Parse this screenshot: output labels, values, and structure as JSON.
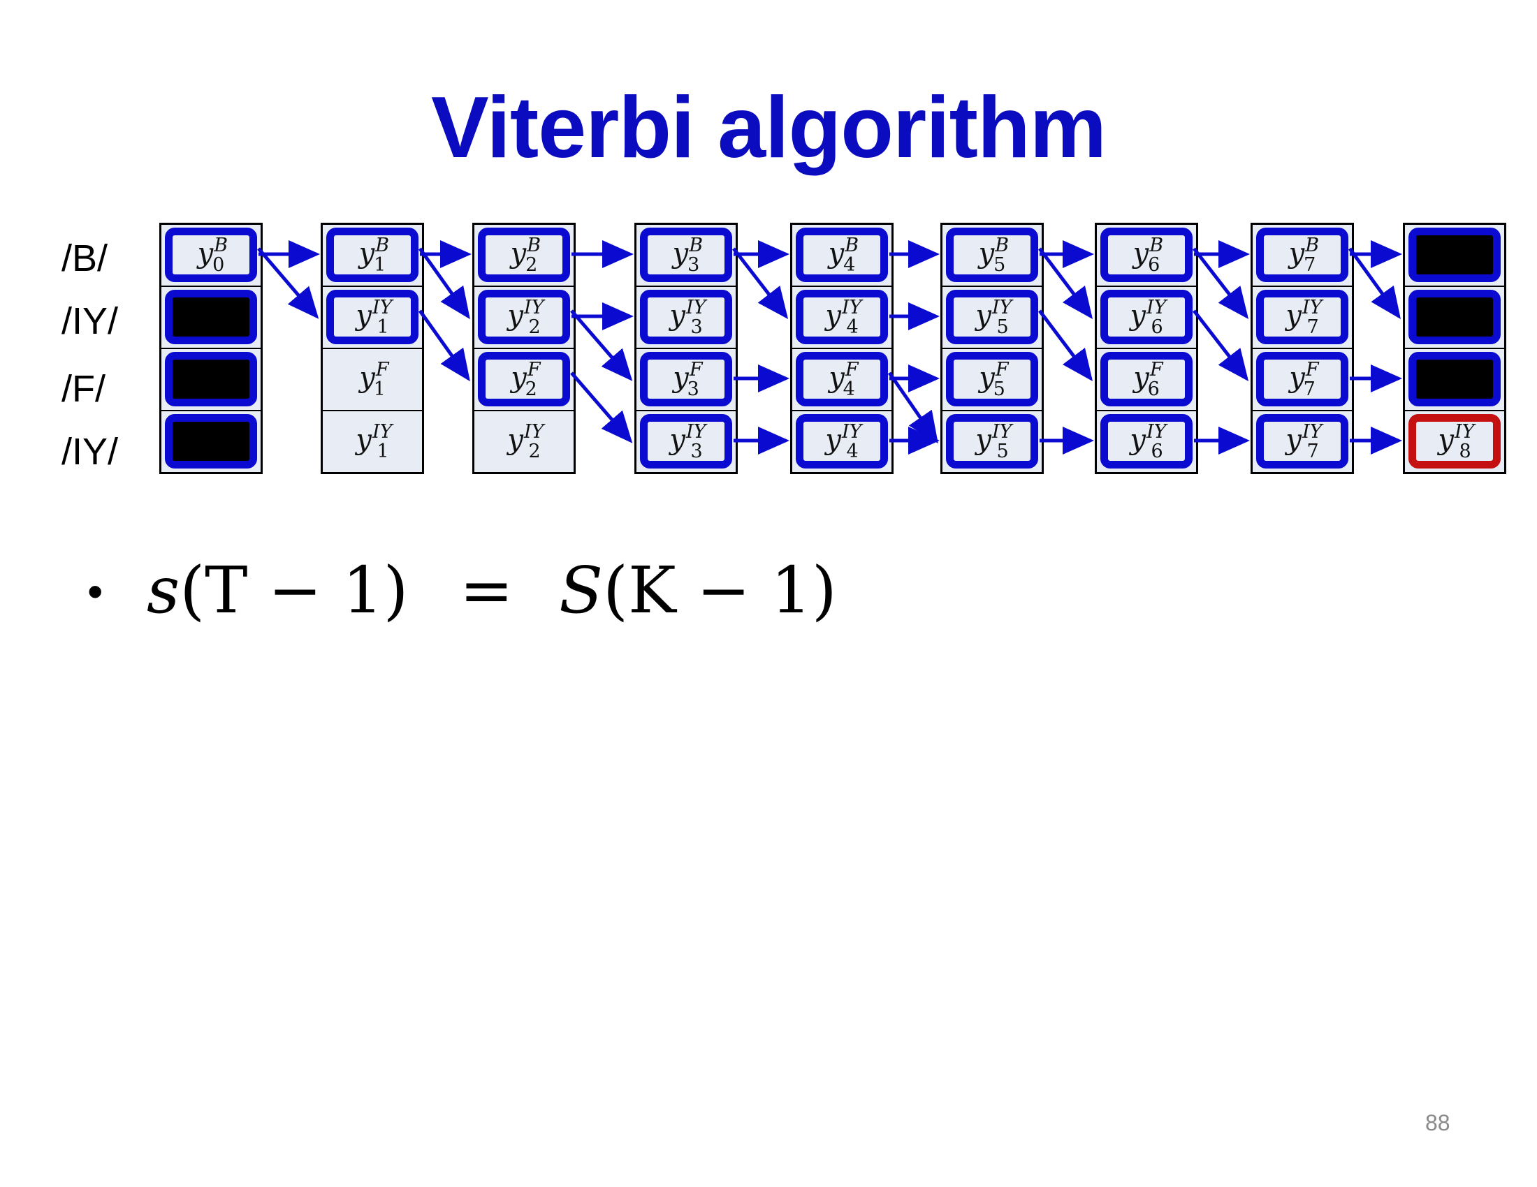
{
  "slide": {
    "title": "Viterbi algorithm",
    "row_labels": [
      "/B/",
      "/IY/",
      "/F/",
      "/IY/"
    ],
    "formula": {
      "lhs_s": "s",
      "lhs_arg": "(T − 1)",
      "eq": "=",
      "rhs_S": "S",
      "rhs_arg": "(K − 1)"
    },
    "bullet": "•",
    "page_number": "88"
  },
  "trellis": {
    "columns": [
      {
        "t": "0",
        "cells": [
          {
            "state": "B",
            "label": "y",
            "sup": "B",
            "sub": "0",
            "visible": true,
            "highlight": "blue",
            "blacked": false
          },
          {
            "state": "IY",
            "label": "",
            "sup": "",
            "sub": "",
            "visible": false,
            "highlight": "blue",
            "blacked": true
          },
          {
            "state": "F",
            "label": "",
            "sup": "",
            "sub": "",
            "visible": false,
            "highlight": "blue",
            "blacked": true
          },
          {
            "state": "IY",
            "label": "",
            "sup": "",
            "sub": "",
            "visible": false,
            "highlight": "blue",
            "blacked": true
          }
        ]
      },
      {
        "t": "1",
        "cells": [
          {
            "state": "B",
            "label": "y",
            "sup": "B",
            "sub": "1",
            "visible": true,
            "highlight": "blue",
            "blacked": false
          },
          {
            "state": "IY",
            "label": "y",
            "sup": "IY",
            "sub": "1",
            "visible": true,
            "highlight": "blue",
            "blacked": false
          },
          {
            "state": "F",
            "label": "y",
            "sup": "F",
            "sub": "1",
            "visible": true,
            "highlight": "none",
            "blacked": false
          },
          {
            "state": "IY",
            "label": "y",
            "sup": "IY",
            "sub": "1",
            "visible": true,
            "highlight": "none",
            "blacked": false
          }
        ]
      },
      {
        "t": "2",
        "cells": [
          {
            "state": "B",
            "label": "y",
            "sup": "B",
            "sub": "2",
            "visible": true,
            "highlight": "blue",
            "blacked": false
          },
          {
            "state": "IY",
            "label": "y",
            "sup": "IY",
            "sub": "2",
            "visible": true,
            "highlight": "blue",
            "blacked": false
          },
          {
            "state": "F",
            "label": "y",
            "sup": "F",
            "sub": "2",
            "visible": true,
            "highlight": "blue",
            "blacked": false
          },
          {
            "state": "IY",
            "label": "y",
            "sup": "IY",
            "sub": "2",
            "visible": true,
            "highlight": "none",
            "blacked": false
          }
        ]
      },
      {
        "t": "3",
        "cells": [
          {
            "state": "B",
            "label": "y",
            "sup": "B",
            "sub": "3",
            "visible": true,
            "highlight": "blue",
            "blacked": false
          },
          {
            "state": "IY",
            "label": "y",
            "sup": "IY",
            "sub": "3",
            "visible": true,
            "highlight": "blue",
            "blacked": false
          },
          {
            "state": "F",
            "label": "y",
            "sup": "F",
            "sub": "3",
            "visible": true,
            "highlight": "blue",
            "blacked": false
          },
          {
            "state": "IY",
            "label": "y",
            "sup": "IY",
            "sub": "3",
            "visible": true,
            "highlight": "blue",
            "blacked": false
          }
        ]
      },
      {
        "t": "4",
        "cells": [
          {
            "state": "B",
            "label": "y",
            "sup": "B",
            "sub": "4",
            "visible": true,
            "highlight": "blue",
            "blacked": false
          },
          {
            "state": "IY",
            "label": "y",
            "sup": "IY",
            "sub": "4",
            "visible": true,
            "highlight": "blue",
            "blacked": false
          },
          {
            "state": "F",
            "label": "y",
            "sup": "F",
            "sub": "4",
            "visible": true,
            "highlight": "blue",
            "blacked": false
          },
          {
            "state": "IY",
            "label": "y",
            "sup": "IY",
            "sub": "4",
            "visible": true,
            "highlight": "blue",
            "blacked": false
          }
        ]
      },
      {
        "t": "5",
        "cells": [
          {
            "state": "B",
            "label": "y",
            "sup": "B",
            "sub": "5",
            "visible": true,
            "highlight": "blue",
            "blacked": false
          },
          {
            "state": "IY",
            "label": "y",
            "sup": "IY",
            "sub": "5",
            "visible": true,
            "highlight": "blue",
            "blacked": false
          },
          {
            "state": "F",
            "label": "y",
            "sup": "F",
            "sub": "5",
            "visible": true,
            "highlight": "blue",
            "blacked": false
          },
          {
            "state": "IY",
            "label": "y",
            "sup": "IY",
            "sub": "5",
            "visible": true,
            "highlight": "blue",
            "blacked": false
          }
        ]
      },
      {
        "t": "6",
        "cells": [
          {
            "state": "B",
            "label": "y",
            "sup": "B",
            "sub": "6",
            "visible": true,
            "highlight": "blue",
            "blacked": false
          },
          {
            "state": "IY",
            "label": "y",
            "sup": "IY",
            "sub": "6",
            "visible": true,
            "highlight": "blue",
            "blacked": false
          },
          {
            "state": "F",
            "label": "y",
            "sup": "F",
            "sub": "6",
            "visible": true,
            "highlight": "blue",
            "blacked": false
          },
          {
            "state": "IY",
            "label": "y",
            "sup": "IY",
            "sub": "6",
            "visible": true,
            "highlight": "blue",
            "blacked": false
          }
        ]
      },
      {
        "t": "7",
        "cells": [
          {
            "state": "B",
            "label": "y",
            "sup": "B",
            "sub": "7",
            "visible": true,
            "highlight": "blue",
            "blacked": false
          },
          {
            "state": "IY",
            "label": "y",
            "sup": "IY",
            "sub": "7",
            "visible": true,
            "highlight": "blue",
            "blacked": false
          },
          {
            "state": "F",
            "label": "y",
            "sup": "F",
            "sub": "7",
            "visible": true,
            "highlight": "blue",
            "blacked": false
          },
          {
            "state": "IY",
            "label": "y",
            "sup": "IY",
            "sub": "7",
            "visible": true,
            "highlight": "blue",
            "blacked": false
          }
        ]
      },
      {
        "t": "8",
        "cells": [
          {
            "state": "B",
            "label": "",
            "sup": "",
            "sub": "",
            "visible": false,
            "highlight": "blue",
            "blacked": true
          },
          {
            "state": "IY",
            "label": "",
            "sup": "",
            "sub": "",
            "visible": false,
            "highlight": "blue",
            "blacked": true
          },
          {
            "state": "F",
            "label": "",
            "sup": "",
            "sub": "",
            "visible": false,
            "highlight": "blue",
            "blacked": true
          },
          {
            "state": "IY",
            "label": "y",
            "sup": "IY",
            "sub": "8",
            "visible": true,
            "highlight": "red",
            "blacked": false
          }
        ]
      }
    ],
    "transitions": [
      {
        "from": [
          0,
          0
        ],
        "to": [
          1,
          0
        ]
      },
      {
        "from": [
          0,
          0
        ],
        "to": [
          1,
          1
        ]
      },
      {
        "from": [
          1,
          0
        ],
        "to": [
          2,
          0
        ]
      },
      {
        "from": [
          1,
          0
        ],
        "to": [
          2,
          1
        ]
      },
      {
        "from": [
          1,
          1
        ],
        "to": [
          2,
          2
        ]
      },
      {
        "from": [
          2,
          0
        ],
        "to": [
          3,
          0
        ]
      },
      {
        "from": [
          2,
          1
        ],
        "to": [
          3,
          1
        ]
      },
      {
        "from": [
          2,
          1
        ],
        "to": [
          3,
          2
        ]
      },
      {
        "from": [
          2,
          2
        ],
        "to": [
          3,
          3
        ]
      },
      {
        "from": [
          3,
          0
        ],
        "to": [
          4,
          0
        ]
      },
      {
        "from": [
          3,
          0
        ],
        "to": [
          4,
          1
        ]
      },
      {
        "from": [
          3,
          2
        ],
        "to": [
          4,
          2
        ]
      },
      {
        "from": [
          3,
          3
        ],
        "to": [
          4,
          3
        ]
      },
      {
        "from": [
          4,
          0
        ],
        "to": [
          5,
          0
        ]
      },
      {
        "from": [
          4,
          1
        ],
        "to": [
          5,
          1
        ]
      },
      {
        "from": [
          4,
          2
        ],
        "to": [
          5,
          2
        ]
      },
      {
        "from": [
          4,
          2
        ],
        "to": [
          5,
          3
        ]
      },
      {
        "from": [
          4,
          3
        ],
        "to": [
          5,
          3
        ]
      },
      {
        "from": [
          5,
          0
        ],
        "to": [
          6,
          0
        ]
      },
      {
        "from": [
          5,
          0
        ],
        "to": [
          6,
          1
        ]
      },
      {
        "from": [
          5,
          1
        ],
        "to": [
          6,
          2
        ]
      },
      {
        "from": [
          5,
          3
        ],
        "to": [
          6,
          3
        ]
      },
      {
        "from": [
          6,
          0
        ],
        "to": [
          7,
          0
        ]
      },
      {
        "from": [
          6,
          0
        ],
        "to": [
          7,
          1
        ]
      },
      {
        "from": [
          6,
          1
        ],
        "to": [
          7,
          2
        ]
      },
      {
        "from": [
          6,
          3
        ],
        "to": [
          7,
          3
        ]
      },
      {
        "from": [
          7,
          0
        ],
        "to": [
          8,
          0
        ]
      },
      {
        "from": [
          7,
          0
        ],
        "to": [
          8,
          1
        ]
      },
      {
        "from": [
          7,
          2
        ],
        "to": [
          8,
          2
        ]
      },
      {
        "from": [
          7,
          3
        ],
        "to": [
          8,
          3
        ]
      }
    ]
  },
  "colors": {
    "title": "#0b0bbf",
    "highlight": "#0a0ad0",
    "final": "#c41010",
    "arrow": "#0a0ad0",
    "cell_bg": "#e8ecf5"
  }
}
